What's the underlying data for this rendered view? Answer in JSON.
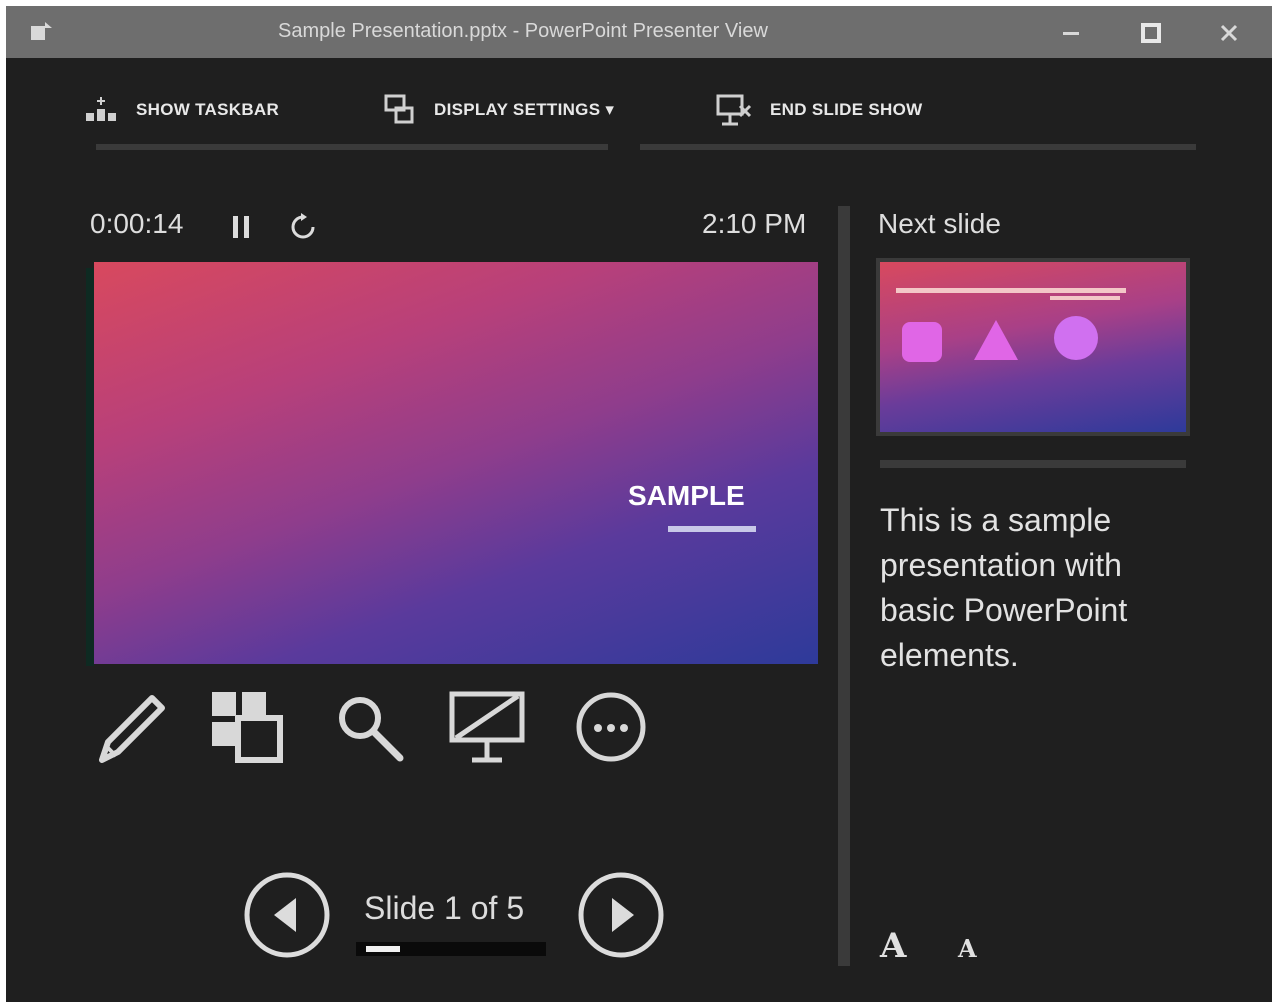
{
  "window": {
    "title": "Sample Presentation.pptx - PowerPoint Presenter View"
  },
  "toolbar": {
    "show_taskbar": "SHOW TASKBAR",
    "display_settings": "DISPLAY SETTINGS ▾",
    "end_slide_show": "END SLIDE SHOW"
  },
  "presenter": {
    "timer": "0:00:14",
    "clock": "2:10 PM",
    "current_slide": {
      "text": "SAMPLE"
    },
    "counter": "Slide 1 of 5",
    "progress_fraction": 0.2
  },
  "next": {
    "label": "Next slide"
  },
  "notes": {
    "text": "This is a sample presentation with basic PowerPoint elements."
  },
  "font_controls": {
    "increase": "A",
    "decrease": "A"
  },
  "colors": {
    "background": "#1f1f1f",
    "titlebar": "#6e6e6e",
    "slide_start": "#d8495e",
    "slide_end": "#2e3a9a"
  }
}
